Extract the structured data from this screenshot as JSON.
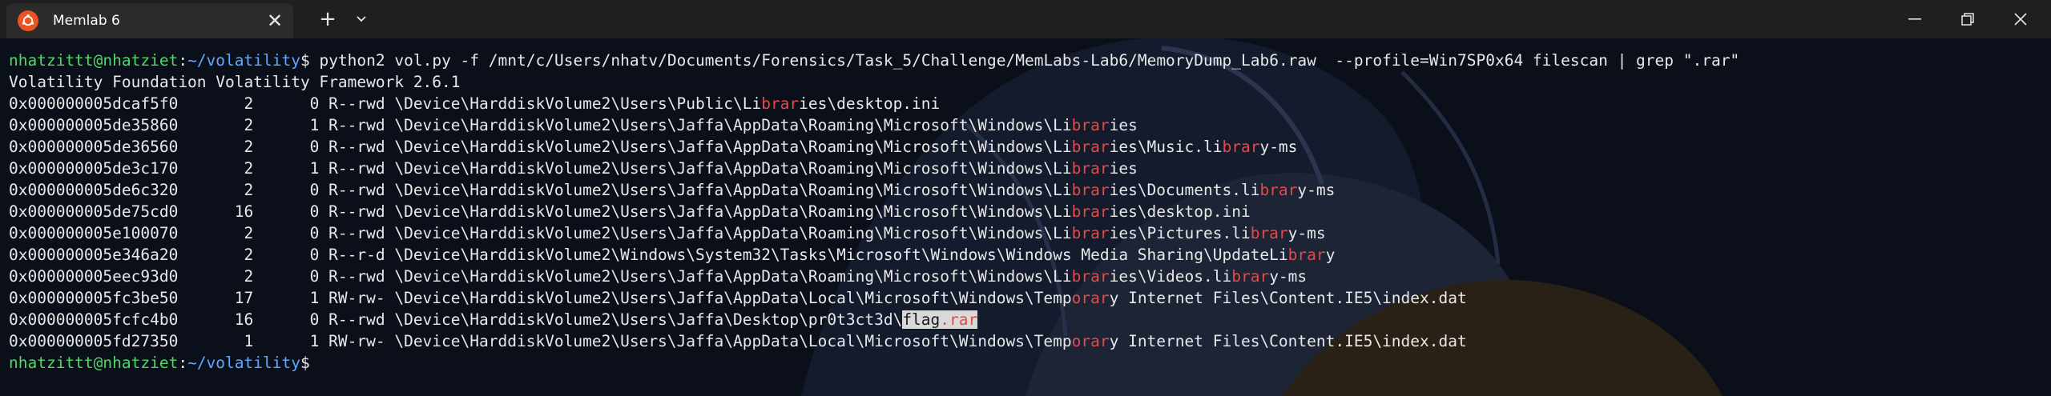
{
  "window": {
    "tab_title": "Memlab 6",
    "tab_close_glyph": "✕",
    "new_tab_glyph": "+",
    "dropdown_glyph": "⌄",
    "minimize_glyph": "—",
    "maximize_glyph": "⧉",
    "close_glyph": "✕"
  },
  "prompt": {
    "user_host": "nhatzittt@nhatziet",
    "sep": ":",
    "path": "~/volatility",
    "symbol": "$"
  },
  "command": " python2 vol.py -f /mnt/c/Users/nhatv/Documents/Forensics/Task_5/Challenge/MemLabs-Lab6/MemoryDump_Lab6.raw  --profile=Win7SP0x64 filescan | grep \".rar\"",
  "banner": "Volatility Foundation Volatility Framework 2.6.1",
  "results": [
    {
      "pre": "0x000000005dcaf5f0       2      0 R--rwd \\Device\\HarddiskVolume2\\Users\\Public\\Li",
      "hl": "brar",
      "post": "ies\\desktop.ini"
    },
    {
      "pre": "0x000000005de35860       2      1 R--rwd \\Device\\HarddiskVolume2\\Users\\Jaffa\\AppData\\Roaming\\Microsoft\\Windows\\Li",
      "hl": "brar",
      "post": "ies"
    },
    {
      "pre": "0x000000005de36560       2      0 R--rwd \\Device\\HarddiskVolume2\\Users\\Jaffa\\AppData\\Roaming\\Microsoft\\Windows\\Li",
      "hl": "brar",
      "post": "ies\\Music.li",
      "hl2": "brar",
      "post2": "y-ms"
    },
    {
      "pre": "0x000000005de3c170       2      1 R--rwd \\Device\\HarddiskVolume2\\Users\\Jaffa\\AppData\\Roaming\\Microsoft\\Windows\\Li",
      "hl": "brar",
      "post": "ies"
    },
    {
      "pre": "0x000000005de6c320       2      0 R--rwd \\Device\\HarddiskVolume2\\Users\\Jaffa\\AppData\\Roaming\\Microsoft\\Windows\\Li",
      "hl": "brar",
      "post": "ies\\Documents.li",
      "hl2": "brar",
      "post2": "y-ms"
    },
    {
      "pre": "0x000000005de75cd0      16      0 R--rwd \\Device\\HarddiskVolume2\\Users\\Jaffa\\AppData\\Roaming\\Microsoft\\Windows\\Li",
      "hl": "brar",
      "post": "ies\\desktop.ini"
    },
    {
      "pre": "0x000000005e100070       2      0 R--rwd \\Device\\HarddiskVolume2\\Users\\Jaffa\\AppData\\Roaming\\Microsoft\\Windows\\Li",
      "hl": "brar",
      "post": "ies\\Pictures.li",
      "hl2": "brar",
      "post2": "y-ms"
    },
    {
      "pre": "0x000000005e346a20       2      0 R--r-d \\Device\\HarddiskVolume2\\Windows\\System32\\Tasks\\Microsoft\\Windows\\Windows Media Sharing\\UpdateLi",
      "hl": "brar",
      "post": "y"
    },
    {
      "pre": "0x000000005eec93d0       2      0 R--rwd \\Device\\HarddiskVolume2\\Users\\Jaffa\\AppData\\Roaming\\Microsoft\\Windows\\Li",
      "hl": "brar",
      "post": "ies\\Videos.li",
      "hl2": "brar",
      "post2": "y-ms"
    },
    {
      "pre": "0x000000005fc3be50      17      1 RW-rw- \\Device\\HarddiskVolume2\\Users\\Jaffa\\AppData\\Local\\Microsoft\\Windows\\Temp",
      "hl": "orar",
      "post": "y Internet Files\\Content.IE5\\index.dat"
    },
    {
      "pre": "0x000000005fcfc4b0      16      0 R--rwd \\Device\\HarddiskVolume2\\Users\\Jaffa\\Desktop\\pr0t3ct3d\\",
      "sel_pre": "flag",
      "hl": ".rar",
      "selected": true
    },
    {
      "pre": "0x000000005fd27350       1      1 RW-rw- \\Device\\HarddiskVolume2\\Users\\Jaffa\\AppData\\Local\\Microsoft\\Windows\\Temp",
      "hl": "orar",
      "post": "y Internet Files\\Content.IE5\\index.dat"
    }
  ]
}
